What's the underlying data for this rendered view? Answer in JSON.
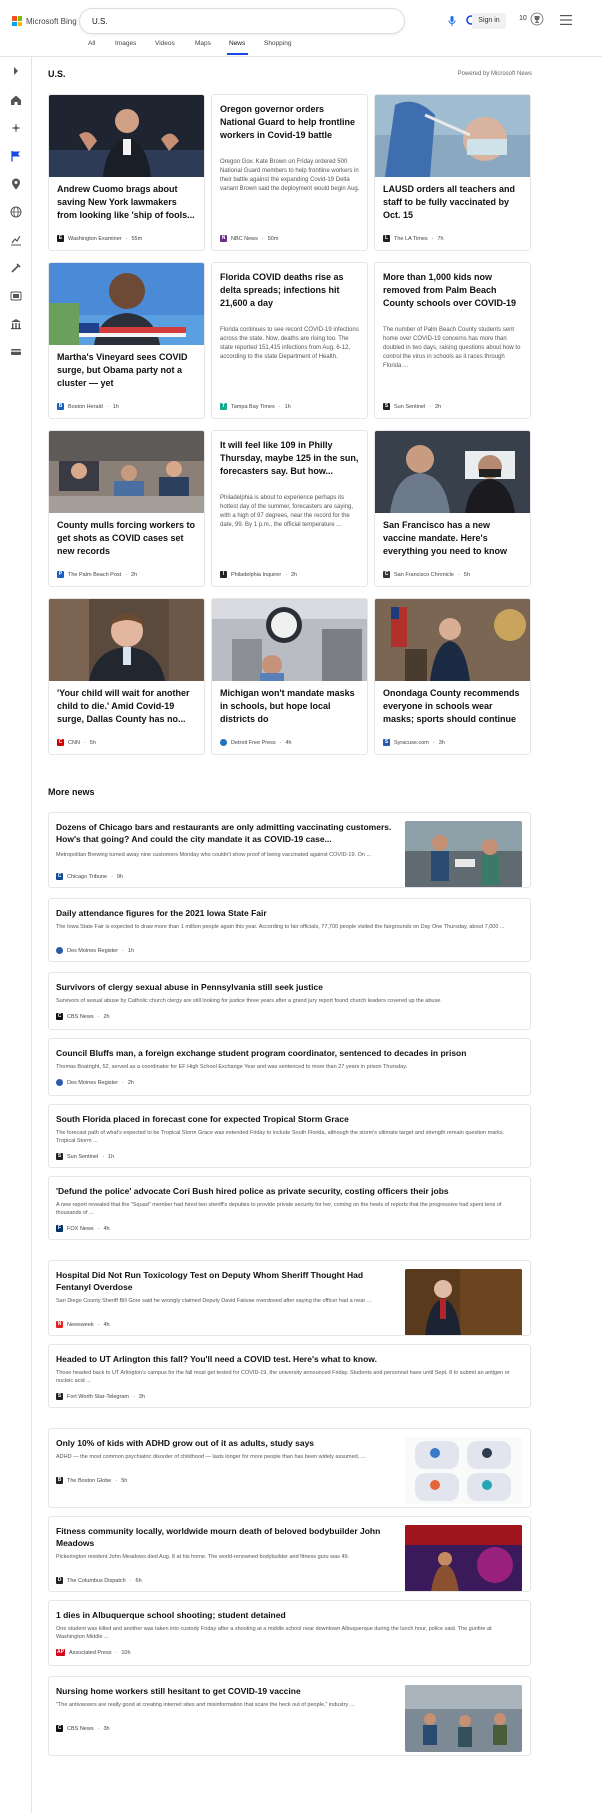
{
  "brand": {
    "name": "Microsoft Bing"
  },
  "search": {
    "query": "U.S."
  },
  "header": {
    "signin": "Sign in",
    "rewards_count": "10"
  },
  "tabs": [
    {
      "label": "All"
    },
    {
      "label": "Images"
    },
    {
      "label": "Videos"
    },
    {
      "label": "Maps"
    },
    {
      "label": "News",
      "active": true
    },
    {
      "label": "Shopping"
    }
  ],
  "rail_icons": [
    "expand-icon",
    "home-icon",
    "discover-icon",
    "flag-icon",
    "location-icon",
    "globe-icon",
    "business-icon",
    "science-icon",
    "entertainment-icon",
    "politics-icon",
    "money-icon"
  ],
  "section": {
    "title": "U.S.",
    "powered_by": "Powered by Microsoft News"
  },
  "cards": [
    {
      "title": "Andrew Cuomo brags about saving New York lawmakers from looking like 'ship of fools...",
      "source": "Washington Examiner",
      "age": "55m",
      "has_image": true,
      "logo_color": "#1a1a1a",
      "logo_letter": "E"
    },
    {
      "title": "Oregon governor orders National Guard to help frontline workers in Covid-19 battle",
      "body": "Oregon Gov. Kate Brown on Friday ordered 500 National Guard members to help frontline workers in their battle against the expanding Covid-19 Delta variant Brown said the deployment would begin Aug.",
      "source": "NBC News",
      "age": "50m",
      "has_image": false,
      "logo_color": "#6a2e8c",
      "logo_letter": "N"
    },
    {
      "title": "LAUSD orders all teachers and staff to be fully vaccinated by Oct. 15",
      "source": "The LA Times",
      "age": "7h",
      "has_image": true,
      "logo_color": "#222",
      "logo_letter": "L"
    },
    {
      "title": "Martha's Vineyard sees COVID surge, but Obama party not a cluster — yet",
      "source": "Boston Herald",
      "age": "1h",
      "has_image": true,
      "logo_color": "#1c5fb8",
      "logo_letter": "B"
    },
    {
      "title": "Florida COVID deaths rise as delta spreads; infections hit 21,600 a day",
      "body": "Florida continues to see record COVID-19 infections across the state. Now, deaths are rising too. The state reported 151,415 infections from Aug. 6-12, according to the state Department of Health.",
      "source": "Tampa Bay Times",
      "age": "1h",
      "has_image": false,
      "logo_color": "#17a68e",
      "logo_letter": "T"
    },
    {
      "title": "More than 1,000 kids now removed from Palm Beach County schools over COVID-19",
      "body": "The number of Palm Beach County students sent home over COVID-19 concerns has more than doubled in two days, raising questions about how to control the virus in schools as it races through Florida ...",
      "source": "Sun Sentinel",
      "age": "2h",
      "has_image": false,
      "logo_color": "#222",
      "logo_letter": "S"
    },
    {
      "title": "County mulls forcing workers to get shots as COVID cases set new records",
      "source": "The Palm Beach Post",
      "age": "2h",
      "has_image": true,
      "logo_color": "#1d5fbf",
      "logo_letter": "P"
    },
    {
      "title": "It will feel like 109 in Philly Thursday, maybe 125 in the sun, forecasters say. But how...",
      "body": "Philadelphia is about to experience perhaps its hottest day of the summer, forecasters are saying, with a high of 97 degrees, near the record for the date, 99. By 1 p.m., the official temperature ...",
      "source": "Philadelphia Inquirer",
      "age": "2h",
      "has_image": false,
      "logo_color": "#222",
      "logo_letter": "I"
    },
    {
      "title": "San Francisco has a new vaccine mandate. Here's everything you need to know",
      "source": "San Francisco Chronicle",
      "age": "5h",
      "has_image": true,
      "logo_color": "#333",
      "logo_letter": "C"
    },
    {
      "title": "'Your child will wait for another child to die.' Amid Covid-19 surge, Dallas County has no...",
      "source": "CNN",
      "age": "5h",
      "has_image": true,
      "logo_color": "#cc0000",
      "logo_letter": "C"
    },
    {
      "title": "Michigan won't mandate masks in schools, but hope local districts do",
      "source": "Detroit Free Press",
      "age": "4h",
      "has_image": true,
      "logo_color": "#1e73be",
      "logo_letter": ""
    },
    {
      "title": "Onondaga County recommends everyone in schools wear masks; sports should continue",
      "source": "Syracuse.com",
      "age": "3h",
      "has_image": true,
      "logo_color": "#2a5aa8",
      "logo_letter": "S"
    }
  ],
  "more_news": {
    "title": "More news",
    "items": [
      {
        "title": "Dozens of Chicago bars and restaurants are only admitting vaccinating customers. How's that going? And could the city mandate it as COVID-19 case...",
        "body": "Metropolitan Brewing turned away nine customers Monday who couldn't show proof of being vaccinated against COVID-19. On ...",
        "source": "Chicago Tribune",
        "age": "9h",
        "has_image": true,
        "logo_color": "#0f4c96",
        "logo_letter": "C"
      },
      {
        "title": "Daily attendance figures for the 2021 Iowa State Fair",
        "body": "The Iowa State Fair is expected to draw more than 1 million people again this year. According to fair officials, 77,700 people visited the fairgrounds on Day One Thursday, about 7,000 ...",
        "source": "Des Moines Register",
        "age": "1h",
        "has_image": false,
        "logo_color": "#2b5aa8",
        "logo_letter": ""
      },
      {
        "title": "Survivors of clergy sexual abuse in Pennsylvania still seek justice",
        "body": "Survivors of sexual abuse by Catholic church clergy are still looking for justice three years after a grand jury report found church leaders covered up the abuse.",
        "source": "CBS News",
        "age": "2h",
        "has_image": false,
        "logo_color": "#111",
        "logo_letter": "C"
      },
      {
        "title": "Council Bluffs man, a foreign exchange student program coordinator, sentenced to decades in prison",
        "body": "Thomas Boatright, 52, served as a coordinator for EF High School Exchange Year and was sentenced to more than 27 years in prison Thursday.",
        "source": "Des Moines Register",
        "age": "2h",
        "has_image": false,
        "logo_color": "#2b5aa8",
        "logo_letter": ""
      },
      {
        "title": "South Florida placed in forecast cone for expected Tropical Storm Grace",
        "body": "The forecast path of what's expected to be Tropical Storm Grace was extended Friday to include South Florida, although the storm's ultimate target and strength remain question marks. Tropical Storm ...",
        "source": "Sun Sentinel",
        "age": "1h",
        "has_image": false,
        "logo_color": "#222",
        "logo_letter": "S"
      },
      {
        "title": "'Defund the police' advocate Cori Bush hired police as private security, costing officers their jobs",
        "body": "A new report revealed that the \"Squad\" member had hired two sheriff's deputies to provide private security for her, coming on the heels of reports that the progressive had spent tens of thousands of ...",
        "source": "FOX News",
        "age": "4h",
        "has_image": false,
        "logo_color": "#003366",
        "logo_letter": "F"
      },
      {
        "title": "Hospital Did Not Run Toxicology Test on Deputy Whom Sheriff Thought Had Fentanyl Overdose",
        "body": "San Diego County Sheriff Bill Gore said he wrongly claimed Deputy David Faiivae overdosed after saying the officer had a near ...",
        "source": "Newsweek",
        "age": "4h",
        "has_image": true,
        "logo_color": "#e0261e",
        "logo_letter": "N"
      },
      {
        "title": "Headed to UT Arlington this fall? You'll need a COVID test. Here's what to know.",
        "body": "Those headed back to UT Arlington's campus for the fall must get tested for COVID-19, the university announced Friday. Students and personnel have until Sept. 8 to submit an antigen or nucleic acid ...",
        "source": "Fort Worth Star-Telegram",
        "age": "3h",
        "has_image": false,
        "logo_color": "#222",
        "logo_letter": "S"
      },
      {
        "title": "Only 10% of kids with ADHD grow out of it as adults, study says",
        "body": "ADHD — the most common psychiatric disorder of childhood — lasts longer for more people than has been widely assumed, ...",
        "source": "The Boston Globe",
        "age": "5h",
        "has_image": true,
        "logo_color": "#222",
        "logo_letter": "B"
      },
      {
        "title": "Fitness community locally, worldwide mourn death of beloved bodybuilder John Meadows",
        "body": "Pickerington resident John Meadows died Aug. 8 at his home. The world-renowned bodybuilder and fitness guru was 49.",
        "source": "The Columbus Dispatch",
        "age": "6h",
        "has_image": true,
        "logo_color": "#222",
        "logo_letter": "D"
      },
      {
        "title": "1 dies in Albuquerque school shooting; student detained",
        "body": "One student was killed and another was taken into custody Friday after a shooting at a middle school near downtown Albuquerque during the lunch hour, police said. The gunfire at Washington Middle ...",
        "source": "Associated Press",
        "age": "10h",
        "has_image": false,
        "logo_color": "#d0021b",
        "logo_letter": "AP"
      },
      {
        "title": "Nursing home workers still hesitant to get COVID-19 vaccine",
        "body": "\"The antivaxxers are really good at creating internet sites and misinformation that scare the heck out of people,\" industry ...",
        "source": "CBS News",
        "age": "3h",
        "has_image": true,
        "logo_color": "#111",
        "logo_letter": "C"
      }
    ]
  }
}
